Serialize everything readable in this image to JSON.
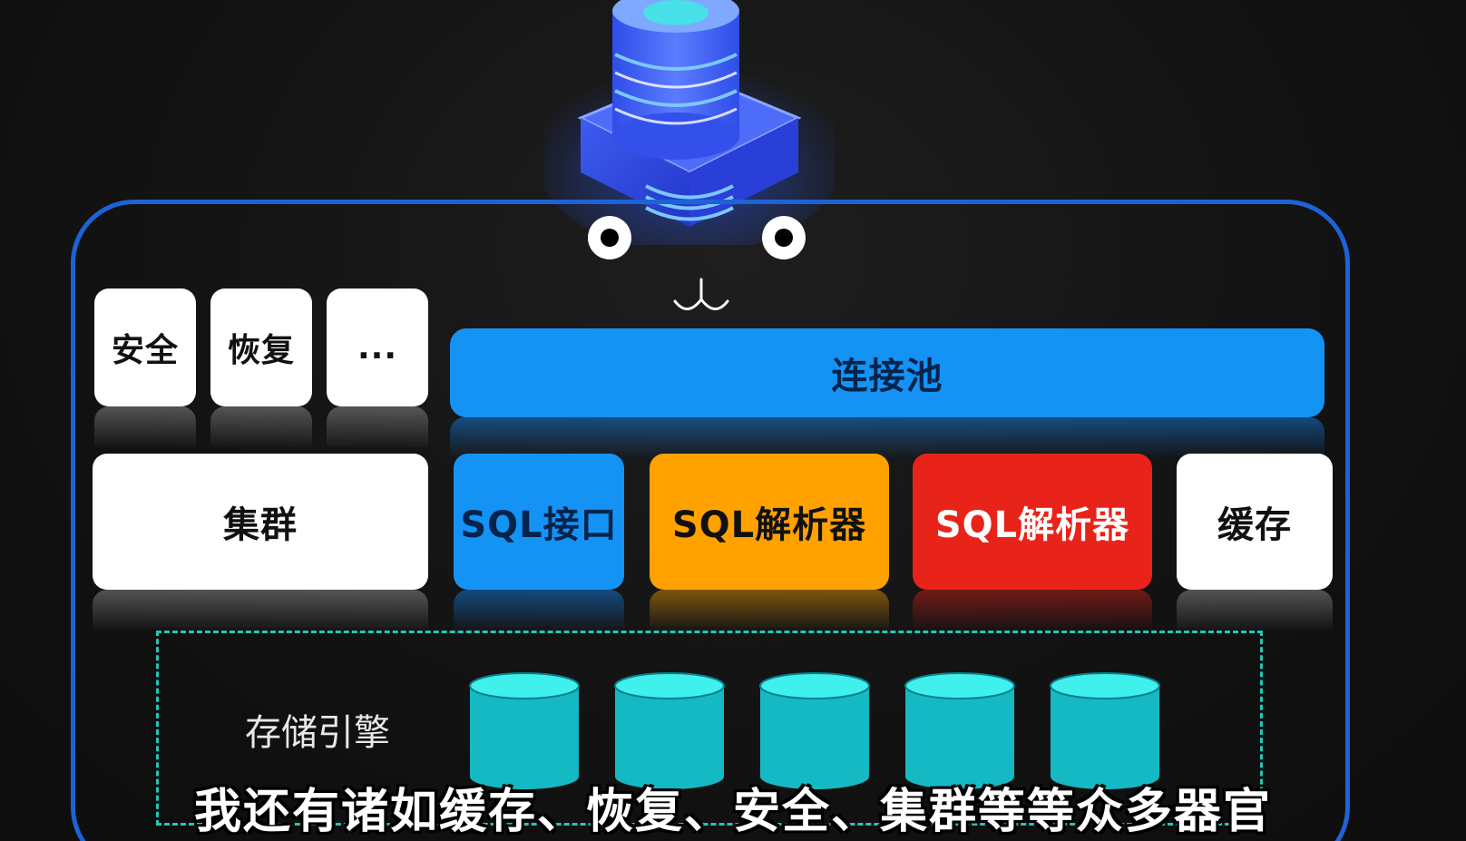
{
  "top_blocks": {
    "security": "安全",
    "recovery": "恢复",
    "more": "..."
  },
  "connection_pool": "连接池",
  "cluster": "集群",
  "modules": [
    {
      "label": "SQL接口",
      "color": "#1493f5",
      "text_color": "#06234a"
    },
    {
      "label": "SQL解析器",
      "color": "#ffa200",
      "text_color": "#111111"
    },
    {
      "label": "SQL解析器",
      "color": "#e8231a",
      "text_color": "#ffffff"
    },
    {
      "label": "缓存",
      "color": "#ffffff",
      "text_color": "#111111"
    }
  ],
  "storage_engine": "存储引擎",
  "storage_cylinder_count": 5,
  "subtitle": "我还有诸如缓存、恢复、安全、集群等等众多器官",
  "colors": {
    "frame_border": "#1c63d6",
    "dashed_border": "#23c6b6",
    "cylinder": "#22d8d8"
  }
}
